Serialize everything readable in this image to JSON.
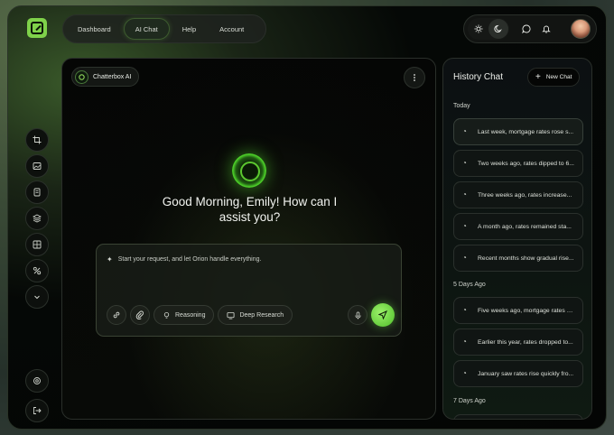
{
  "topnav": {
    "items": [
      {
        "label": "Dashboard"
      },
      {
        "label": "AI Chat",
        "active": true
      },
      {
        "label": "Help"
      },
      {
        "label": "Account"
      }
    ]
  },
  "topright": {
    "icons": [
      "sun-icon",
      "moon-icon",
      "chat-icon",
      "bell-icon"
    ],
    "theme": "dark"
  },
  "sidebar": {
    "icons": [
      "crop-icon",
      "image-icon",
      "document-icon",
      "stack-icon",
      "grid-icon",
      "percent-icon",
      "chevron-down-icon"
    ],
    "bottom_icons": [
      "settings-icon",
      "logout-icon"
    ]
  },
  "main": {
    "chip_label": "Chatterbox AI",
    "greeting": "Good Morning, Emily! How can I assist you?",
    "composer": {
      "placeholder": "Start your request, and let Orion handle everything.",
      "reasoning_label": "Reasoning",
      "deep_research_label": "Deep Research"
    }
  },
  "history": {
    "title": "History Chat",
    "new_chat_label": "New Chat",
    "sections": [
      {
        "label": "Today",
        "items": [
          "Last week, mortgage rates rose s...",
          "Two weeks ago, rates dipped to 6...",
          "Three weeks ago, rates increase...",
          "A month ago, rates remained sta...",
          "Recent months show gradual rise..."
        ]
      },
      {
        "label": "5 Days Ago",
        "items": [
          "Five weeks ago, mortgage rates a...",
          "Earlier this year, rates dropped to...",
          "January saw rates rise quickly fro..."
        ]
      },
      {
        "label": "7 Days Ago",
        "items": []
      }
    ]
  },
  "colors": {
    "accent": "#6fe03a",
    "background": "#050605"
  }
}
